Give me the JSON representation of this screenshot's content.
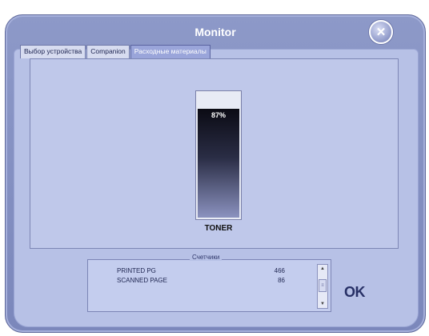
{
  "window": {
    "title": "Monitor"
  },
  "tabs": [
    {
      "label": "Выбор устройства"
    },
    {
      "label": "Companion"
    },
    {
      "label": "Расходные материалы"
    }
  ],
  "toner": {
    "percent_label": "87%",
    "level": 0.87,
    "label": "TONER"
  },
  "counters": {
    "legend": "Счетчики",
    "rows": [
      {
        "name": "PRINTED PG",
        "value": "466"
      },
      {
        "name": "SCANNED PAGE",
        "value": "86"
      }
    ]
  },
  "buttons": {
    "ok_label": "OK",
    "close_glyph": "✕"
  },
  "icons": {
    "close": "close-icon"
  }
}
